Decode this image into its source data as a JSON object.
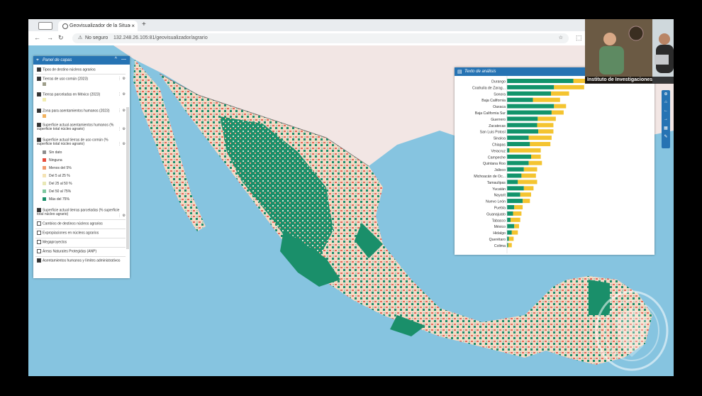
{
  "browser": {
    "tab_title": "Geovisualizador de la Situac",
    "tab_close": "×",
    "new_tab": "+",
    "not_secure": "No seguro",
    "url": "132.248.26.105:81/geovisualizador/agrario"
  },
  "left_panel": {
    "title": "Panel de capas",
    "rows": [
      {
        "label": "Tipos de destino núcleos agrarios",
        "kind": "check"
      },
      {
        "label": "Tierras de uso común (2023)",
        "kind": "check",
        "swatch": "#9e9e8a"
      },
      {
        "label": "Tierras parceladas en México (2023)",
        "kind": "check",
        "swatch": "#f1ecb0"
      },
      {
        "label": "Zona para asentamientos humanos (2023)",
        "kind": "check",
        "swatch": "#f2b25e"
      },
      {
        "label": "Superficie actual asentamientos humanos (% superficie total núcleo agrario)",
        "kind": "check"
      },
      {
        "label": "Superficie actual tierras de uso común (% superficie total núcleo agrario)",
        "kind": "check"
      }
    ],
    "legend": [
      {
        "label": "Sin dato",
        "color": "#8d8d8d"
      },
      {
        "label": "Ninguna",
        "color": "#e74c3c"
      },
      {
        "label": "Menos del 5%",
        "color": "#f19a6e"
      },
      {
        "label": "Del 5 al 25 %",
        "color": "#f4e3b4"
      },
      {
        "label": "Del 25 al 50 %",
        "color": "#e8e8b6"
      },
      {
        "label": "Del 50 al 75%",
        "color": "#7fc8a0"
      },
      {
        "label": "Más del 75%",
        "color": "#1a8f6a"
      }
    ],
    "more_rows": [
      {
        "label": "Superficie actual tierras parceladas (% superficie total núcleo agrario)",
        "kind": "check"
      },
      {
        "label": "Cambios de destinos núcleos agrarios",
        "kind": "plus"
      },
      {
        "label": "Expropiaciones en núcleos agrarios",
        "kind": "plus"
      },
      {
        "label": "Megaproyectos",
        "kind": "plus"
      },
      {
        "label": "Áreas Naturales Protegidas (ANP)",
        "kind": "plus"
      },
      {
        "label": "Asentamientos humanos y límites administrativos",
        "kind": "check"
      }
    ]
  },
  "right_panel": {
    "title": "Texto de análisis"
  },
  "chart_data": {
    "type": "bar",
    "stacked": true,
    "orientation": "horizontal",
    "categories": [
      "Durango",
      "Coahuila de Zarag...",
      "Sonora",
      "Baja California",
      "Oaxaca",
      "Baja California Sur",
      "Guerrero",
      "Zacatecas",
      "San Luis Potosí",
      "Sinaloa",
      "Chiapas",
      "Veracruz",
      "Campeche",
      "Quintana Roo",
      "Jalisco",
      "Michoacán de Oc...",
      "Tamaulipas",
      "Yucatán",
      "Nayarit",
      "Nuevo León",
      "Puebla",
      "Guanajuato",
      "Tabasco",
      "México",
      "Hidalgo",
      "Querétaro",
      "Colima"
    ],
    "series": [
      {
        "color": "#12946b",
        "values": [
          110,
          78,
          73,
          43,
          78,
          74,
          51,
          50,
          52,
          36,
          38,
          4,
          40,
          36,
          28,
          24,
          18,
          28,
          22,
          26,
          12,
          10,
          6,
          12,
          8,
          3,
          2
        ]
      },
      {
        "color": "#f4c430",
        "values": [
          45,
          50,
          30,
          45,
          20,
          20,
          30,
          27,
          25,
          38,
          34,
          52,
          16,
          22,
          22,
          24,
          32,
          16,
          18,
          12,
          14,
          14,
          16,
          8,
          10,
          8,
          6
        ]
      }
    ]
  },
  "webcam": {
    "caption": "Instituto de Investigaciones"
  }
}
